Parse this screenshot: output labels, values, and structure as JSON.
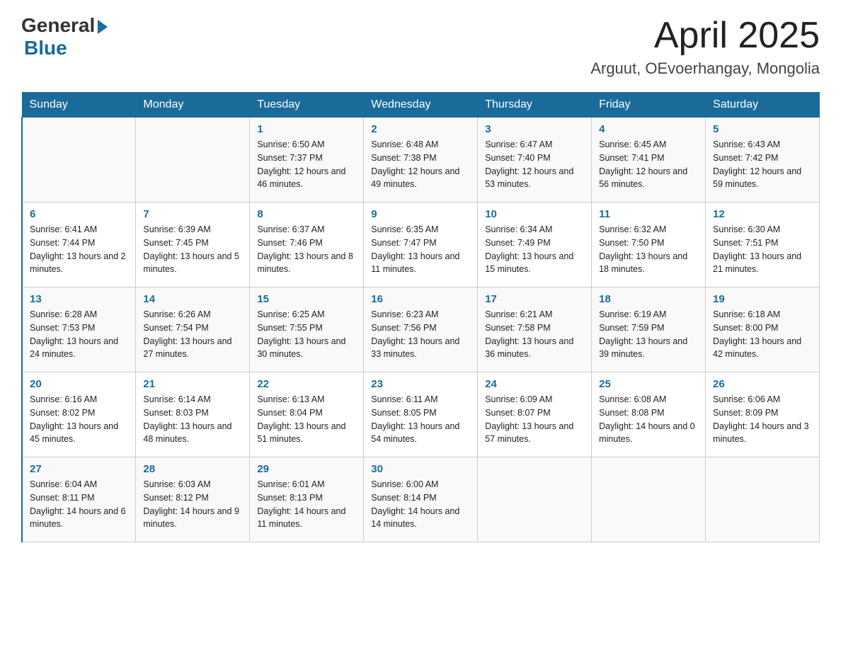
{
  "header": {
    "logo_general": "General",
    "logo_blue": "Blue",
    "title": "April 2025",
    "subtitle": "Arguut, OEvoerhangay, Mongolia"
  },
  "weekdays": [
    "Sunday",
    "Monday",
    "Tuesday",
    "Wednesday",
    "Thursday",
    "Friday",
    "Saturday"
  ],
  "weeks": [
    [
      {
        "day": "",
        "sunrise": "",
        "sunset": "",
        "daylight": ""
      },
      {
        "day": "",
        "sunrise": "",
        "sunset": "",
        "daylight": ""
      },
      {
        "day": "1",
        "sunrise": "Sunrise: 6:50 AM",
        "sunset": "Sunset: 7:37 PM",
        "daylight": "Daylight: 12 hours and 46 minutes."
      },
      {
        "day": "2",
        "sunrise": "Sunrise: 6:48 AM",
        "sunset": "Sunset: 7:38 PM",
        "daylight": "Daylight: 12 hours and 49 minutes."
      },
      {
        "day": "3",
        "sunrise": "Sunrise: 6:47 AM",
        "sunset": "Sunset: 7:40 PM",
        "daylight": "Daylight: 12 hours and 53 minutes."
      },
      {
        "day": "4",
        "sunrise": "Sunrise: 6:45 AM",
        "sunset": "Sunset: 7:41 PM",
        "daylight": "Daylight: 12 hours and 56 minutes."
      },
      {
        "day": "5",
        "sunrise": "Sunrise: 6:43 AM",
        "sunset": "Sunset: 7:42 PM",
        "daylight": "Daylight: 12 hours and 59 minutes."
      }
    ],
    [
      {
        "day": "6",
        "sunrise": "Sunrise: 6:41 AM",
        "sunset": "Sunset: 7:44 PM",
        "daylight": "Daylight: 13 hours and 2 minutes."
      },
      {
        "day": "7",
        "sunrise": "Sunrise: 6:39 AM",
        "sunset": "Sunset: 7:45 PM",
        "daylight": "Daylight: 13 hours and 5 minutes."
      },
      {
        "day": "8",
        "sunrise": "Sunrise: 6:37 AM",
        "sunset": "Sunset: 7:46 PM",
        "daylight": "Daylight: 13 hours and 8 minutes."
      },
      {
        "day": "9",
        "sunrise": "Sunrise: 6:35 AM",
        "sunset": "Sunset: 7:47 PM",
        "daylight": "Daylight: 13 hours and 11 minutes."
      },
      {
        "day": "10",
        "sunrise": "Sunrise: 6:34 AM",
        "sunset": "Sunset: 7:49 PM",
        "daylight": "Daylight: 13 hours and 15 minutes."
      },
      {
        "day": "11",
        "sunrise": "Sunrise: 6:32 AM",
        "sunset": "Sunset: 7:50 PM",
        "daylight": "Daylight: 13 hours and 18 minutes."
      },
      {
        "day": "12",
        "sunrise": "Sunrise: 6:30 AM",
        "sunset": "Sunset: 7:51 PM",
        "daylight": "Daylight: 13 hours and 21 minutes."
      }
    ],
    [
      {
        "day": "13",
        "sunrise": "Sunrise: 6:28 AM",
        "sunset": "Sunset: 7:53 PM",
        "daylight": "Daylight: 13 hours and 24 minutes."
      },
      {
        "day": "14",
        "sunrise": "Sunrise: 6:26 AM",
        "sunset": "Sunset: 7:54 PM",
        "daylight": "Daylight: 13 hours and 27 minutes."
      },
      {
        "day": "15",
        "sunrise": "Sunrise: 6:25 AM",
        "sunset": "Sunset: 7:55 PM",
        "daylight": "Daylight: 13 hours and 30 minutes."
      },
      {
        "day": "16",
        "sunrise": "Sunrise: 6:23 AM",
        "sunset": "Sunset: 7:56 PM",
        "daylight": "Daylight: 13 hours and 33 minutes."
      },
      {
        "day": "17",
        "sunrise": "Sunrise: 6:21 AM",
        "sunset": "Sunset: 7:58 PM",
        "daylight": "Daylight: 13 hours and 36 minutes."
      },
      {
        "day": "18",
        "sunrise": "Sunrise: 6:19 AM",
        "sunset": "Sunset: 7:59 PM",
        "daylight": "Daylight: 13 hours and 39 minutes."
      },
      {
        "day": "19",
        "sunrise": "Sunrise: 6:18 AM",
        "sunset": "Sunset: 8:00 PM",
        "daylight": "Daylight: 13 hours and 42 minutes."
      }
    ],
    [
      {
        "day": "20",
        "sunrise": "Sunrise: 6:16 AM",
        "sunset": "Sunset: 8:02 PM",
        "daylight": "Daylight: 13 hours and 45 minutes."
      },
      {
        "day": "21",
        "sunrise": "Sunrise: 6:14 AM",
        "sunset": "Sunset: 8:03 PM",
        "daylight": "Daylight: 13 hours and 48 minutes."
      },
      {
        "day": "22",
        "sunrise": "Sunrise: 6:13 AM",
        "sunset": "Sunset: 8:04 PM",
        "daylight": "Daylight: 13 hours and 51 minutes."
      },
      {
        "day": "23",
        "sunrise": "Sunrise: 6:11 AM",
        "sunset": "Sunset: 8:05 PM",
        "daylight": "Daylight: 13 hours and 54 minutes."
      },
      {
        "day": "24",
        "sunrise": "Sunrise: 6:09 AM",
        "sunset": "Sunset: 8:07 PM",
        "daylight": "Daylight: 13 hours and 57 minutes."
      },
      {
        "day": "25",
        "sunrise": "Sunrise: 6:08 AM",
        "sunset": "Sunset: 8:08 PM",
        "daylight": "Daylight: 14 hours and 0 minutes."
      },
      {
        "day": "26",
        "sunrise": "Sunrise: 6:06 AM",
        "sunset": "Sunset: 8:09 PM",
        "daylight": "Daylight: 14 hours and 3 minutes."
      }
    ],
    [
      {
        "day": "27",
        "sunrise": "Sunrise: 6:04 AM",
        "sunset": "Sunset: 8:11 PM",
        "daylight": "Daylight: 14 hours and 6 minutes."
      },
      {
        "day": "28",
        "sunrise": "Sunrise: 6:03 AM",
        "sunset": "Sunset: 8:12 PM",
        "daylight": "Daylight: 14 hours and 9 minutes."
      },
      {
        "day": "29",
        "sunrise": "Sunrise: 6:01 AM",
        "sunset": "Sunset: 8:13 PM",
        "daylight": "Daylight: 14 hours and 11 minutes."
      },
      {
        "day": "30",
        "sunrise": "Sunrise: 6:00 AM",
        "sunset": "Sunset: 8:14 PM",
        "daylight": "Daylight: 14 hours and 14 minutes."
      },
      {
        "day": "",
        "sunrise": "",
        "sunset": "",
        "daylight": ""
      },
      {
        "day": "",
        "sunrise": "",
        "sunset": "",
        "daylight": ""
      },
      {
        "day": "",
        "sunrise": "",
        "sunset": "",
        "daylight": ""
      }
    ]
  ]
}
